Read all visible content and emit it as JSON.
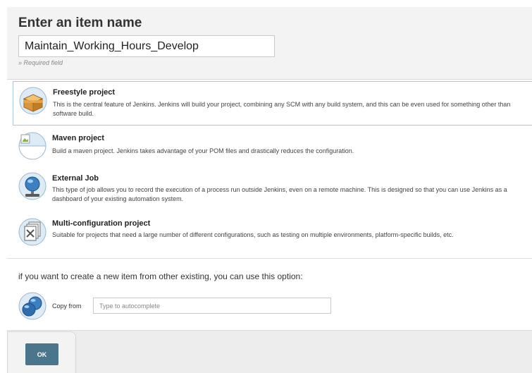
{
  "form": {
    "title": "Enter an item name",
    "item_name_value": "Maintain_Working_Hours_Develop",
    "required_hint": "» Required field"
  },
  "item_types": [
    {
      "title": "Freestyle project",
      "description": "This is the central feature of Jenkins. Jenkins will build your project, combining any SCM with any build system, and this can be even used for something other than software build.",
      "icon": "freestyle-project-icon",
      "selected": true
    },
    {
      "title": "Maven project",
      "description": "Build a maven project. Jenkins takes advantage of your POM files and drastically reduces the configuration.",
      "icon": "broken-image-icon",
      "selected": false
    },
    {
      "title": "External Job",
      "description": "This type of job allows you to record the execution of a process run outside Jenkins, even on a remote machine. This is designed so that you can use Jenkins as a dashboard of your existing automation system.",
      "icon": "external-job-icon",
      "selected": false
    },
    {
      "title": "Multi-configuration project",
      "description": "Suitable for projects that need a large number of different configurations, such as testing on multiple environments, platform-specific builds, etc.",
      "icon": "multi-configuration-icon",
      "selected": false
    }
  ],
  "copy": {
    "prompt": "if you want to create a new item from other existing, you can use this option:",
    "label": "Copy from",
    "placeholder": "Type to autocomplete",
    "icon": "copy-item-icon"
  },
  "footer": {
    "ok_label": "OK"
  },
  "colors": {
    "ok_button": "#4b758b",
    "selected_border": "#a8c6e0",
    "panel_background": "#f3f3f3"
  }
}
